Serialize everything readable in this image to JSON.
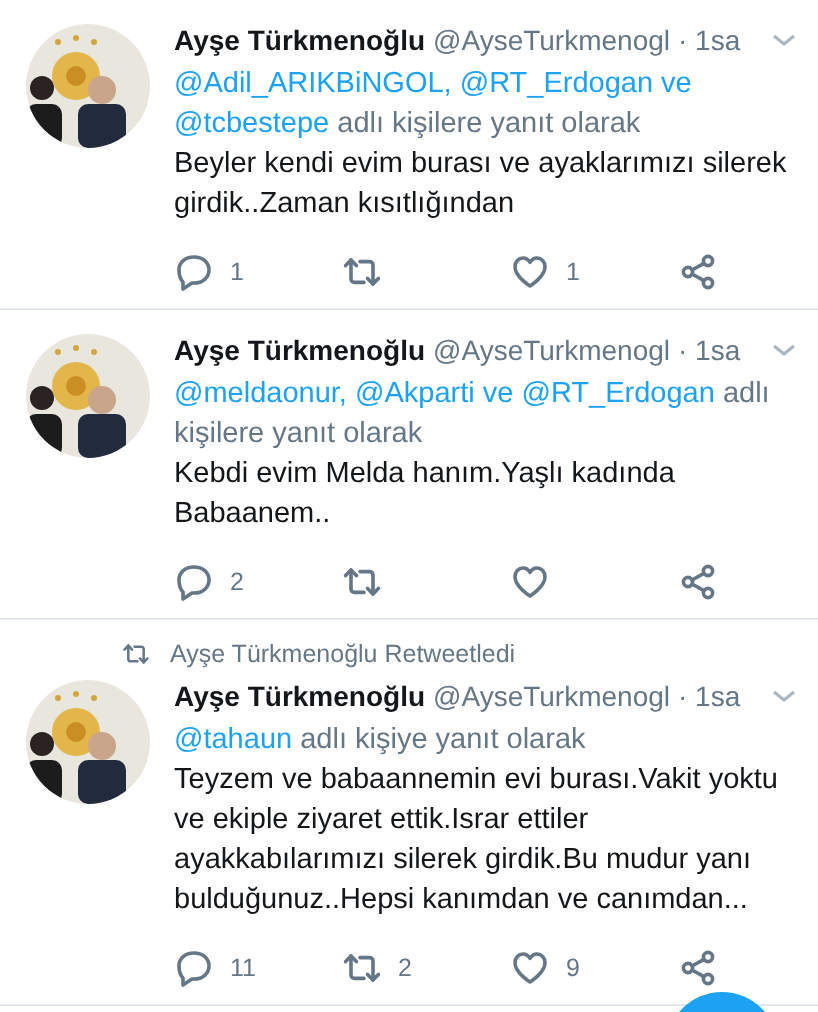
{
  "tweets": [
    {
      "name": "Ayşe Türkmenoğlu",
      "handle": "@AyseTurkmenogl",
      "time": "· 1sa",
      "reply_to": [
        {
          "kind": "mention",
          "text": "@Adil_ARIKBiNGOL,"
        },
        {
          "kind": "mention",
          "text": "@RT_Erdogan ve"
        },
        {
          "kind": "mention",
          "text": "@tcbestepe"
        },
        {
          "kind": "plain",
          "text": "adlı kişilere yanıt olarak"
        }
      ],
      "text": "Beyler kendi evim burası ve ayaklarımızı silerek girdik..Zaman kısıtlığından",
      "actions": [
        {
          "kind": "reply",
          "count": "1"
        },
        {
          "kind": "retweet"
        },
        {
          "kind": "like",
          "count": "1"
        },
        {
          "kind": "share"
        }
      ]
    },
    {
      "name": "Ayşe Türkmenoğlu",
      "handle": "@AyseTurkmenogl",
      "time": "· 1sa",
      "reply_to": [
        {
          "kind": "mention",
          "text": "@meldaonur,"
        },
        {
          "kind": "mention",
          "text": "@Akparti ve"
        },
        {
          "kind": "mention",
          "text": "@RT_Erdogan"
        },
        {
          "kind": "plain",
          "text": "adlı kişilere yanıt olarak"
        }
      ],
      "text": "Kebdi evim Melda hanım.Yaşlı kadında Babaanem..",
      "actions": [
        {
          "kind": "reply",
          "count": "2"
        },
        {
          "kind": "retweet"
        },
        {
          "kind": "like"
        },
        {
          "kind": "share"
        }
      ]
    },
    {
      "retweeted_by": "Ayşe Türkmenoğlu Retweetledi",
      "name": "Ayşe Türkmenoğlu",
      "handle": "@AyseTurkmenogl",
      "time": "· 1sa",
      "reply_to": [
        {
          "kind": "mention",
          "text": "@tahaun"
        },
        {
          "kind": "plain",
          "text": "adlı kişiye yanıt olarak"
        }
      ],
      "text": "Teyzem ve babaannemin evi burası.Vakit yoktu ve ekiple ziyaret ettik.Israr ettiler ayakkabılarımızı silerek girdik.Bu mudur yanı bulduğunuz..Hepsi kanımdan ve canımdan...",
      "actions": [
        {
          "kind": "reply",
          "count": "11"
        },
        {
          "kind": "retweet",
          "count": "2"
        },
        {
          "kind": "like",
          "count": "9"
        },
        {
          "kind": "share"
        }
      ]
    }
  ]
}
